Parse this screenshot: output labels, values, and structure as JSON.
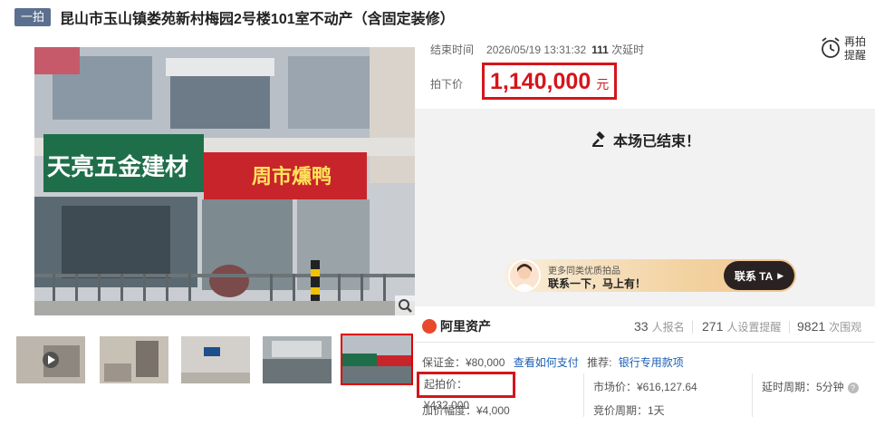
{
  "header": {
    "badge": "一拍",
    "title": "昆山市玉山镇娄苑新村梅园2号楼101室不动产（含固定装修）"
  },
  "photo": {
    "shop_sign_left": "天亮五金建材",
    "shop_sign_right": "周市燻鸭"
  },
  "auction": {
    "end_label": "结束时间",
    "end_time": "2026/05/19 13:31:32",
    "delay_count": "111",
    "delay_label": "次延时",
    "remind_label": "再拍提醒",
    "price_label": "拍下价",
    "price": "1,140,000",
    "price_unit": "元",
    "ended_text": "本场已结束！"
  },
  "contact": {
    "small_text": "更多同类优质拍品",
    "big_text": "联系一下，马上有！",
    "button": "联系 TA"
  },
  "platform": {
    "name": "阿里资产"
  },
  "stats": {
    "signups": "33",
    "signups_label": "人报名",
    "reminders": "271",
    "reminders_label": "人设置提醒",
    "views": "9821",
    "views_label": "次围观"
  },
  "details": {
    "deposit": "保证金：¥80,000",
    "how_to_pay": "查看如何支付",
    "recommend_label": "推荐:",
    "recommend_link": "银行专用款项",
    "start_price": "起拍价：¥432,000",
    "market_price": "市场价：¥616,127.64",
    "delay_period": "延时周期：5分钟",
    "increment": "加价幅度：¥4,000",
    "bid_cycle": "竞价周期：1天"
  },
  "colors": {
    "accent_red": "#d5151b",
    "link_blue": "#1a5fb4",
    "badge_bg": "#5b6f8e"
  }
}
